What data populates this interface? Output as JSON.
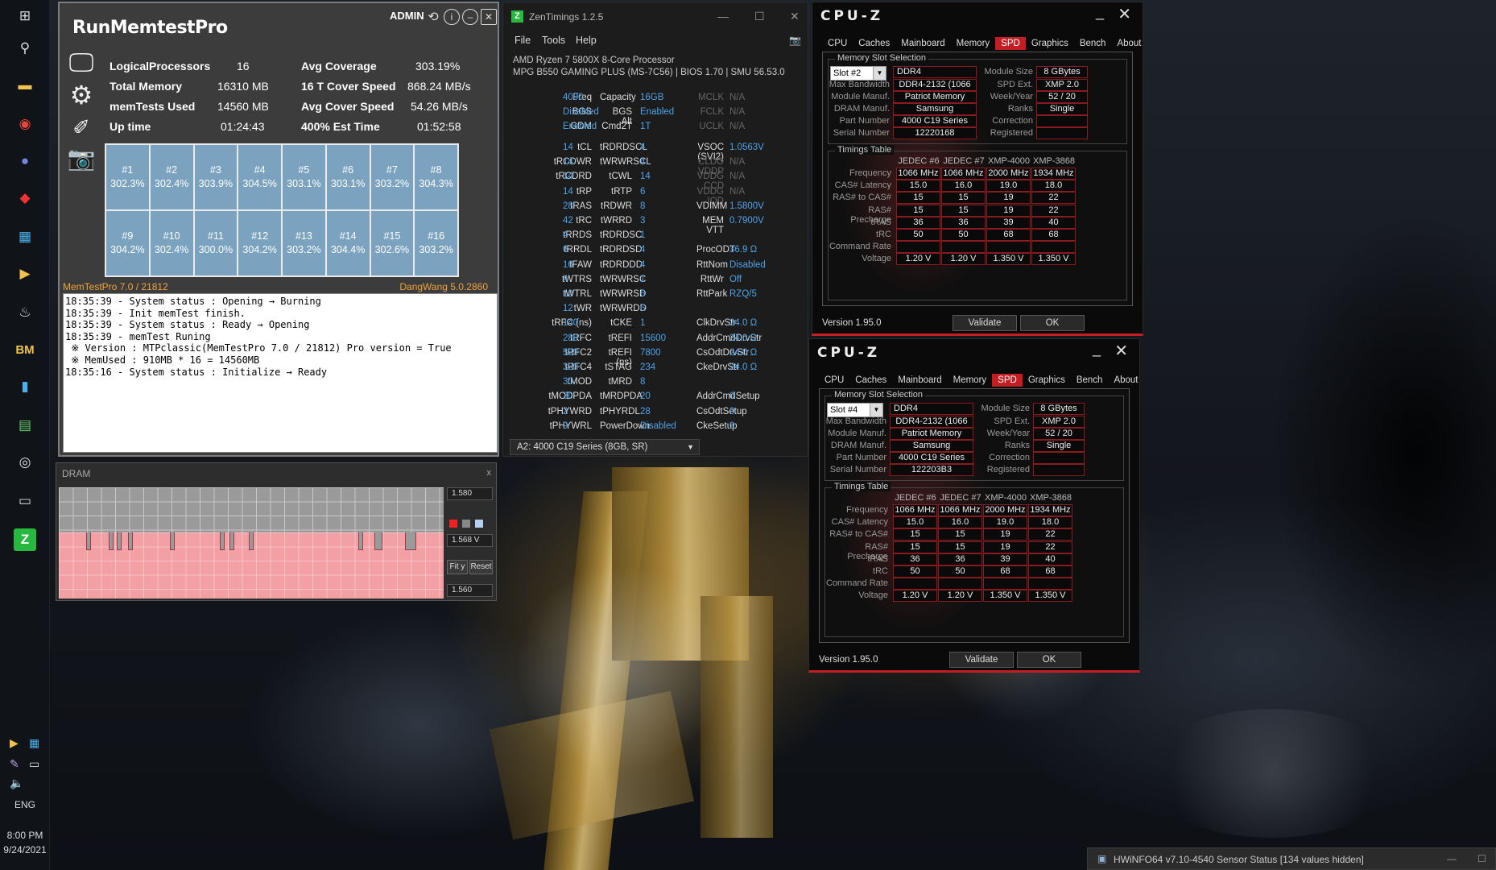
{
  "taskbar": {
    "lang": "ENG",
    "time": "8:00 PM",
    "date": "9/24/2021"
  },
  "runmemtest": {
    "title": "RunMemtestPro",
    "admin": "ADMIN",
    "stats": [
      {
        "label": "LogicalProcessors",
        "value": "16",
        "label2": "Avg Coverage",
        "value2": "303.19%"
      },
      {
        "label": "Total Memory",
        "value": "16310 MB",
        "label2": "16 T Cover Speed",
        "value2": "868.24 MB/s"
      },
      {
        "label": "memTests Used",
        "value": "14560 MB",
        "label2": "Avg Cover Speed",
        "value2": "54.26 MB/s"
      },
      {
        "label": "Up time",
        "value": "01:24:43",
        "label2": "400% Est Time",
        "value2": "01:52:58"
      }
    ],
    "cells": [
      {
        "id": "#1",
        "pct": "302.3%"
      },
      {
        "id": "#2",
        "pct": "302.4%"
      },
      {
        "id": "#3",
        "pct": "303.9%"
      },
      {
        "id": "#4",
        "pct": "304.5%"
      },
      {
        "id": "#5",
        "pct": "303.1%"
      },
      {
        "id": "#6",
        "pct": "303.1%"
      },
      {
        "id": "#7",
        "pct": "303.2%"
      },
      {
        "id": "#8",
        "pct": "304.3%"
      },
      {
        "id": "#9",
        "pct": "304.2%"
      },
      {
        "id": "#10",
        "pct": "302.4%"
      },
      {
        "id": "#11",
        "pct": "300.0%"
      },
      {
        "id": "#12",
        "pct": "304.2%"
      },
      {
        "id": "#13",
        "pct": "303.2%"
      },
      {
        "id": "#14",
        "pct": "304.4%"
      },
      {
        "id": "#15",
        "pct": "302.6%"
      },
      {
        "id": "#16",
        "pct": "303.2%"
      }
    ],
    "footer_left": "MemTestPro 7.0 / 21812",
    "footer_right": "DangWang 5.0.2860",
    "log": "18:35:39 - System status : Opening → Burning\n18:35:39 - Init memTest finish.\n18:35:39 - System status : Ready → Opening\n18:35:39 - memTest Runing\n ※ Version : MTPclassic(MemTestPro 7.0 / 21812) Pro version = True\n ※ MemUsed : 910MB * 16 = 14560MB\n18:35:16 - System status : Initialize → Ready"
  },
  "dram": {
    "title": "DRAM",
    "close": "x",
    "max": "1.580",
    "current": "1.568 V",
    "min": "1.560",
    "fit": "Fit y",
    "reset": "Reset"
  },
  "zentimings": {
    "title": "ZenTimings 1.2.5",
    "menu": [
      "File",
      "Tools",
      "Help"
    ],
    "cpu": "AMD Ryzen 7 5800X 8-Core Processor",
    "board": "MPG B550 GAMING PLUS (MS-7C56) | BIOS 1.70 | SMU 56.53.0",
    "top": [
      [
        "Freq",
        "4000",
        "Capacity",
        "16GB",
        "MCLK",
        "N/A"
      ],
      [
        "BGS",
        "Disabled",
        "BGS Alt",
        "Enabled",
        "FCLK",
        "N/A"
      ],
      [
        "GDM",
        "Enabled",
        "Cmd2T",
        "1T",
        "UCLK",
        "N/A"
      ]
    ],
    "rows": [
      [
        "tCL",
        "14",
        "tRDRDSCL",
        "4",
        "VSOC (SVI2)",
        "1.0563V"
      ],
      [
        "tRCDWR",
        "14",
        "tWRWRSCL",
        "4",
        "CLDO VDDP",
        "N/A"
      ],
      [
        "tRCDRD",
        "14",
        "tCWL",
        "14",
        "VDDG CCD",
        "N/A"
      ],
      [
        "tRP",
        "14",
        "tRTP",
        "6",
        "VDDG IOD",
        "N/A"
      ],
      [
        "tRAS",
        "28",
        "tRDWR",
        "8",
        "VDIMM",
        "1.5800V"
      ],
      [
        "tRC",
        "42",
        "tWRRD",
        "3",
        "MEM VTT",
        "0.7900V"
      ],
      [
        "tRRDS",
        "4",
        "tRDRDSC",
        "1",
        "",
        ""
      ],
      [
        "tRRDL",
        "6",
        "tRDRDSD",
        "4",
        "ProcODT",
        "36.9 Ω"
      ],
      [
        "tFAW",
        "16",
        "tRDRDDD",
        "4",
        "RttNom",
        "Disabled"
      ],
      [
        "tWTRS",
        "4",
        "tWRWRSC",
        "1",
        "RttWr",
        "Off"
      ],
      [
        "tWTRL",
        "12",
        "tWRWRSD",
        "6",
        "RttPark",
        "RZQ/5"
      ],
      [
        "tWR",
        "12",
        "tWRWRDD",
        "6",
        "",
        ""
      ],
      [
        "tRFC (ns)",
        "140",
        "tCKE",
        "1",
        "ClkDrvStr",
        "24.0 Ω"
      ],
      [
        "tRFC",
        "280",
        "tREFI",
        "15600",
        "AddrCmdDrvStr",
        "24.0 Ω"
      ],
      [
        "tRFC2",
        "520",
        "tREFI (ns)",
        "7800",
        "CsOdtDrvStr",
        "24.0 Ω"
      ],
      [
        "tRFC4",
        "320",
        "tSTAG",
        "234",
        "CkeDrvStr",
        "24.0 Ω"
      ],
      [
        "tMOD",
        "30",
        "tMRD",
        "8",
        "",
        ""
      ],
      [
        "tMODPDA",
        "30",
        "tMRDPDA",
        "20",
        "AddrCmdSetup",
        "0"
      ],
      [
        "tPHYWRD",
        "2",
        "tPHYRDL",
        "28",
        "CsOdtSetup",
        "0"
      ],
      [
        "tPHYWRL",
        "9",
        "PowerDown",
        "Disabled",
        "CkeSetup",
        "0"
      ]
    ],
    "module": "A2: 4000 C19 Series (8GB, SR)"
  },
  "cpuz": [
    {
      "logo": "CPU-Z",
      "tabs": [
        "CPU",
        "Caches",
        "Mainboard",
        "Memory",
        "SPD",
        "Graphics",
        "Bench",
        "About"
      ],
      "active": "SPD",
      "slot_group": "Memory Slot Selection",
      "slot": "Slot #2",
      "type": "DDR4",
      "module_size": "8 GBytes",
      "max_bw": "DDR4-2132 (1066 MHz)",
      "spd_ext": "XMP 2.0",
      "manuf": "Patriot Memory",
      "week": "52 / 20",
      "dram_manuf": "Samsung",
      "ranks": "Single",
      "part": "4000 C19 Series",
      "correction": "",
      "serial": "12220168",
      "registered": "",
      "timings_group": "Timings Table",
      "cols": [
        "JEDEC #6",
        "JEDEC #7",
        "XMP-4000",
        "XMP-3868"
      ],
      "freq": [
        "1066 MHz",
        "1066 MHz",
        "2000 MHz",
        "1934 MHz"
      ],
      "cas": [
        "15.0",
        "16.0",
        "19.0",
        "18.0"
      ],
      "rcd": [
        "15",
        "15",
        "19",
        "22"
      ],
      "rp": [
        "15",
        "15",
        "19",
        "22"
      ],
      "tras": [
        "36",
        "36",
        "39",
        "40"
      ],
      "trc": [
        "50",
        "50",
        "68",
        "68"
      ],
      "cr": [
        "",
        "",
        "",
        ""
      ],
      "volt": [
        "1.20 V",
        "1.20 V",
        "1.350 V",
        "1.350 V"
      ],
      "version": "Version 1.95.0",
      "validate": "Validate",
      "ok": "OK"
    },
    {
      "logo": "CPU-Z",
      "tabs": [
        "CPU",
        "Caches",
        "Mainboard",
        "Memory",
        "SPD",
        "Graphics",
        "Bench",
        "About"
      ],
      "active": "SPD",
      "slot_group": "Memory Slot Selection",
      "slot": "Slot #4",
      "type": "DDR4",
      "module_size": "8 GBytes",
      "max_bw": "DDR4-2132 (1066 MHz)",
      "spd_ext": "XMP 2.0",
      "manuf": "Patriot Memory",
      "week": "52 / 20",
      "dram_manuf": "Samsung",
      "ranks": "Single",
      "part": "4000 C19 Series",
      "correction": "",
      "serial": "122203B3",
      "registered": "",
      "timings_group": "Timings Table",
      "cols": [
        "JEDEC #6",
        "JEDEC #7",
        "XMP-4000",
        "XMP-3868"
      ],
      "freq": [
        "1066 MHz",
        "1066 MHz",
        "2000 MHz",
        "1934 MHz"
      ],
      "cas": [
        "15.0",
        "16.0",
        "19.0",
        "18.0"
      ],
      "rcd": [
        "15",
        "15",
        "19",
        "22"
      ],
      "rp": [
        "15",
        "15",
        "19",
        "22"
      ],
      "tras": [
        "36",
        "36",
        "39",
        "40"
      ],
      "trc": [
        "50",
        "50",
        "68",
        "68"
      ],
      "cr": [
        "",
        "",
        "",
        ""
      ],
      "volt": [
        "1.20 V",
        "1.20 V",
        "1.350 V",
        "1.350 V"
      ],
      "version": "Version 1.95.0",
      "validate": "Validate",
      "ok": "OK"
    }
  ],
  "labels": {
    "max_bw": "Max Bandwidth",
    "manuf": "Module Manuf.",
    "dram_manuf": "DRAM Manuf.",
    "part": "Part Number",
    "serial": "Serial Number",
    "module_size": "Module Size",
    "spd_ext": "SPD Ext.",
    "week": "Week/Year",
    "ranks": "Ranks",
    "correction": "Correction",
    "registered": "Registered",
    "freq": "Frequency",
    "cas": "CAS# Latency",
    "rcd": "RAS# to CAS#",
    "rp": "RAS# Precharge",
    "tras": "tRAS",
    "trc": "tRC",
    "cr": "Command Rate",
    "volt": "Voltage"
  },
  "hwinfo": {
    "title": "HWiNFO64 v7.10-4540 Sensor Status [134 values hidden]"
  }
}
